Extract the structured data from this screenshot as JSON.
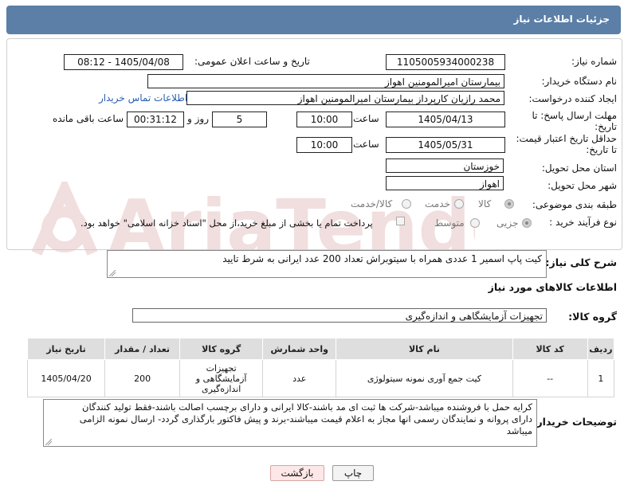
{
  "header": {
    "title": "جزئیات اطلاعات نیاز"
  },
  "form": {
    "need_number_label": "شماره نیاز:",
    "need_number": "1105005934000238",
    "announce_label": "تاریخ و ساعت اعلان عمومی:",
    "announce_value": "1405/04/08 - 08:12",
    "buyer_label": "نام دستگاه خریدار:",
    "buyer_value": "بیمارستان امیرالمومنین اهواز",
    "creator_label": "ایجاد کننده درخواست:",
    "creator_value": "محمد رازیان کارپرداز بیمارستان امیرالمومنین اهواز",
    "contact_link": "اطلاعات تماس خریدار",
    "deadline_label_1": "مهلت ارسال پاسخ: تا",
    "deadline_label_2": "تاریخ:",
    "deadline_date": "1405/04/13",
    "time_label": "ساعت",
    "deadline_time": "10:00",
    "days_value": "5",
    "days_label": "روز و",
    "remaining_value": "00:31:12",
    "remaining_label": "ساعت باقی مانده",
    "validity_label_1": "حداقل تاریخ اعتبار قیمت:",
    "validity_label_2": "تا تاریخ:",
    "validity_date": "1405/05/31",
    "validity_time": "10:00",
    "province_label": "استان محل تحویل:",
    "province_value": "خوزستان",
    "city_label": "شهر محل تحویل:",
    "city_value": "اهواز",
    "category_label": "طبقه بندی موضوعی:",
    "category_options": [
      "کالا",
      "خدمت",
      "کالا/خدمت"
    ],
    "process_label": "نوع فرآیند خرید :",
    "process_options": [
      "جزیی",
      "متوسط"
    ],
    "payment_note": "پرداخت تمام یا بخشی از مبلغ خرید،از محل \"اسناد خزانه اسلامی\" خواهد بود."
  },
  "description": {
    "label": "شرح کلی نیاز:",
    "value": "کیت پاپ اسمیر 1 عددی همراه با سیتوبراش تعداد 200 عدد ایرانی به شرط تایید"
  },
  "goods": {
    "section_title": "اطلاعات کالاهای مورد نیاز",
    "group_label": "گروه کالا:",
    "group_value": "تجهیزات آزمایشگاهی و اندازه‌گیری",
    "columns": [
      "ردیف",
      "کد کالا",
      "نام کالا",
      "واحد شمارش",
      "گروه کالا",
      "تعداد / مقدار",
      "تاریخ نیاز"
    ],
    "rows": [
      {
        "row": "1",
        "code": "--",
        "name": "کیت جمع آوری نمونه سیتولوژی",
        "unit": "عدد",
        "group_lines": [
          "تجهیزات",
          "آزمایشگاهی و",
          "اندازه‌گیری"
        ],
        "qty": "200",
        "date": "1405/04/20"
      }
    ]
  },
  "buyer_notes": {
    "label": "توضیحات خریدار:",
    "lines": [
      "کرایه حمل با فروشنده میباشد-شرکت ها ثبت ای مد باشند-کالا ایرانی و دارای برچسب اصالت باشند-فقط تولید کنندگان",
      "دارای پروانه و نمایندگان رسمی انها مجاز به اعلام قیمت میباشند-برند و پیش فاکتور بارگذاری گردد- ارسال نمونه الزامی",
      "میباشد"
    ]
  },
  "buttons": {
    "print": "چاپ",
    "back": "بازگشت"
  },
  "watermark": "AriaTender.net",
  "colors": {
    "header": "#5b7fa6",
    "back_button": "#fde7e7",
    "watermark": "#f1dede"
  }
}
